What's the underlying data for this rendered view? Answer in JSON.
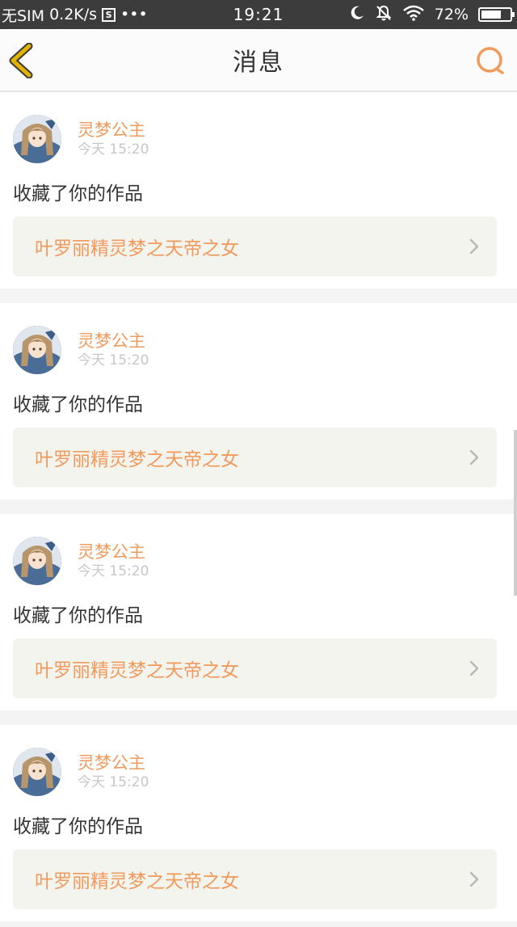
{
  "status_bar": {
    "carrier": "无SIM",
    "speed": "0.2K/s",
    "s_icon_letter": "S",
    "dots": "•••",
    "time": "19:21",
    "battery": "72%",
    "battery_level": 0.72
  },
  "nav": {
    "title": "消息",
    "back_icon": "chevron-left-icon",
    "search_icon": "search-icon"
  },
  "colors": {
    "accent": "#f09a5c",
    "back_icon": "#e1b300",
    "status_bar_bg": "#3c3c3c"
  },
  "messages": [
    {
      "user": "灵梦公主",
      "time": "今天 15:20",
      "action": "收藏了你的作品",
      "work": "叶罗丽精灵梦之天帝之女"
    },
    {
      "user": "灵梦公主",
      "time": "今天 15:20",
      "action": "收藏了你的作品",
      "work": "叶罗丽精灵梦之天帝之女"
    },
    {
      "user": "灵梦公主",
      "time": "今天 15:20",
      "action": "收藏了你的作品",
      "work": "叶罗丽精灵梦之天帝之女"
    },
    {
      "user": "灵梦公主",
      "time": "今天 15:20",
      "action": "收藏了你的作品",
      "work": "叶罗丽精灵梦之天帝之女"
    }
  ]
}
